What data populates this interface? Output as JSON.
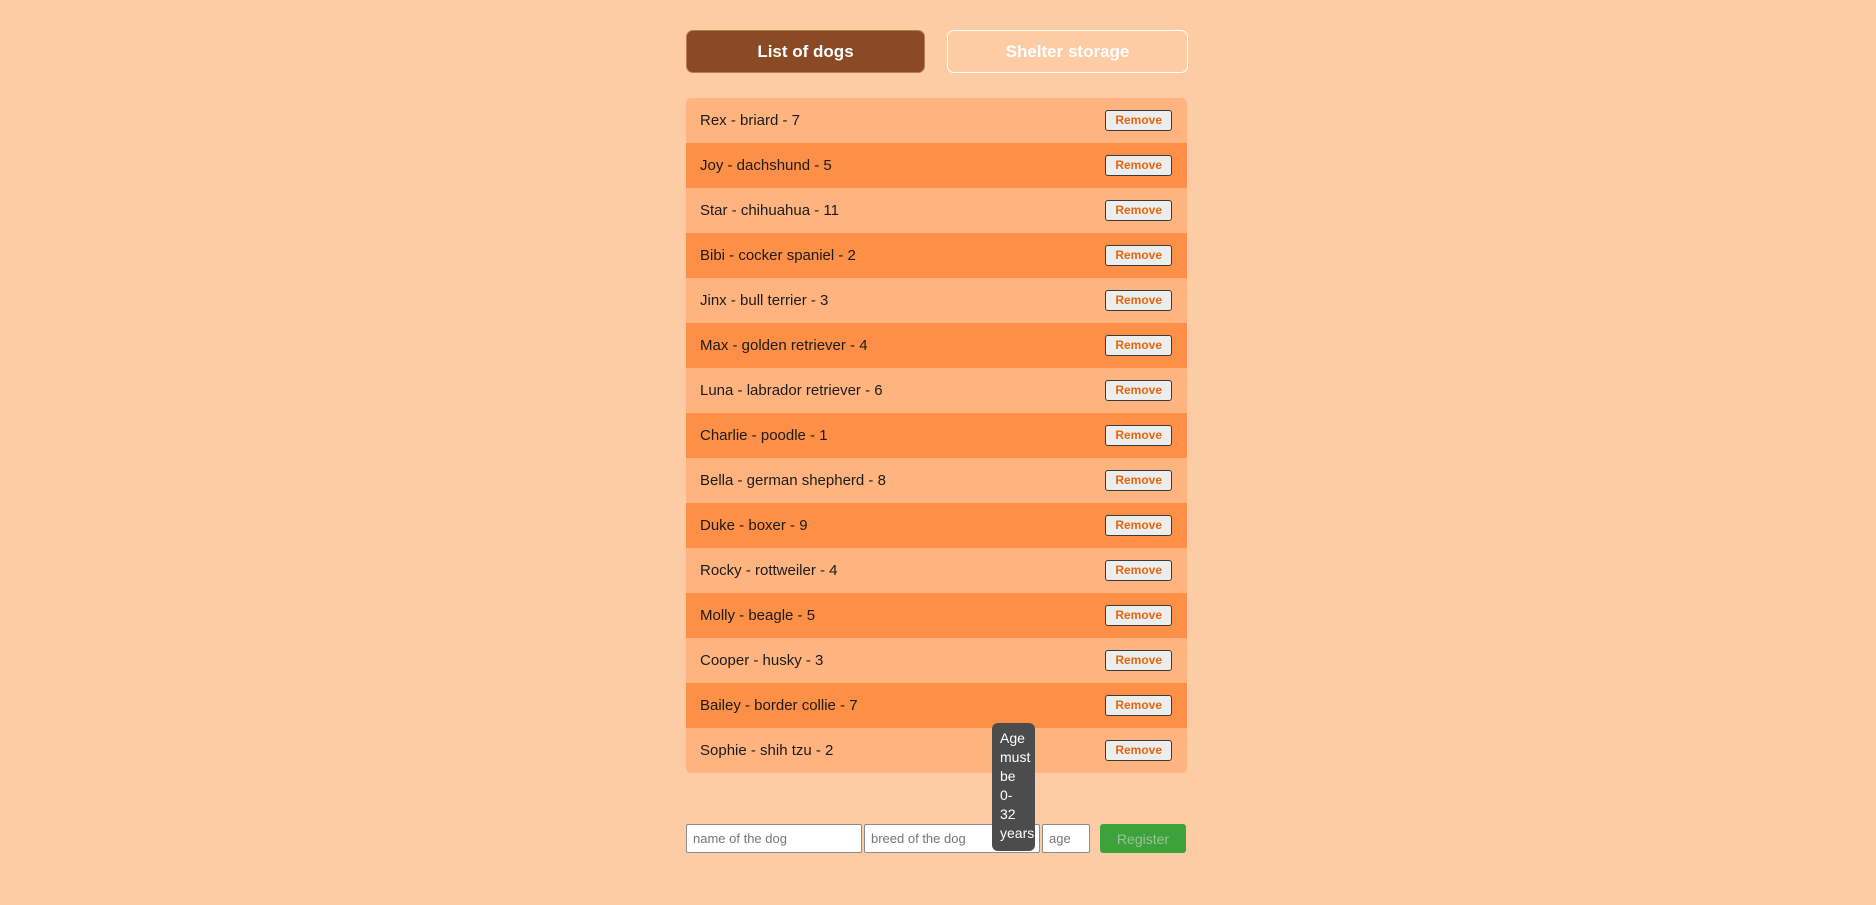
{
  "tabs": [
    {
      "label": "List of dogs",
      "active": true
    },
    {
      "label": "Shelter storage",
      "active": false
    }
  ],
  "colors": {
    "page_background": "#fdcba4",
    "row_odd": "#ffb480",
    "row_even": "#fd8f46",
    "tab_active_bg": "#8a4b24",
    "tab_active_text": "#ffffff",
    "tab_inactive_text": "#ffffff",
    "remove_text": "#e8650d",
    "register_bg": "#3da23a",
    "register_text": "#9ac397",
    "tooltip_bg": "#4c4c4c"
  },
  "list": {
    "remove_label": "Remove",
    "dogs": [
      {
        "name": "Rex",
        "breed": "briard",
        "age": 7,
        "text": "Rex - briard - 7"
      },
      {
        "name": "Joy",
        "breed": "dachshund",
        "age": 5,
        "text": "Joy - dachshund - 5"
      },
      {
        "name": "Star",
        "breed": "chihuahua",
        "age": 11,
        "text": "Star - chihuahua - 11"
      },
      {
        "name": "Bibi",
        "breed": "cocker spaniel",
        "age": 2,
        "text": "Bibi - cocker spaniel - 2"
      },
      {
        "name": "Jinx",
        "breed": "bull terrier",
        "age": 3,
        "text": "Jinx - bull terrier - 3"
      },
      {
        "name": "Max",
        "breed": "golden retriever",
        "age": 4,
        "text": "Max - golden retriever - 4"
      },
      {
        "name": "Luna",
        "breed": "labrador retriever",
        "age": 6,
        "text": "Luna - labrador retriever - 6"
      },
      {
        "name": "Charlie",
        "breed": "poodle",
        "age": 1,
        "text": "Charlie - poodle - 1"
      },
      {
        "name": "Bella",
        "breed": "german shepherd",
        "age": 8,
        "text": "Bella - german shepherd - 8"
      },
      {
        "name": "Duke",
        "breed": "boxer",
        "age": 9,
        "text": "Duke - boxer - 9"
      },
      {
        "name": "Rocky",
        "breed": "rottweiler",
        "age": 4,
        "text": "Rocky - rottweiler - 4"
      },
      {
        "name": "Molly",
        "breed": "beagle",
        "age": 5,
        "text": "Molly - beagle - 5"
      },
      {
        "name": "Cooper",
        "breed": "husky",
        "age": 3,
        "text": "Cooper - husky - 3"
      },
      {
        "name": "Bailey",
        "breed": "border collie",
        "age": 7,
        "text": "Bailey - border collie - 7"
      },
      {
        "name": "Sophie",
        "breed": "shih tzu",
        "age": 2,
        "text": "Sophie - shih tzu - 2"
      }
    ]
  },
  "tooltip": {
    "text": "Age must be 0-32 years",
    "visible": true
  },
  "form": {
    "name_placeholder": "name of the dog",
    "name_value": "",
    "breed_placeholder": "breed of the dog",
    "breed_value": "",
    "age_placeholder": "age",
    "age_value": "",
    "register_label": "Register",
    "register_disabled": true
  }
}
